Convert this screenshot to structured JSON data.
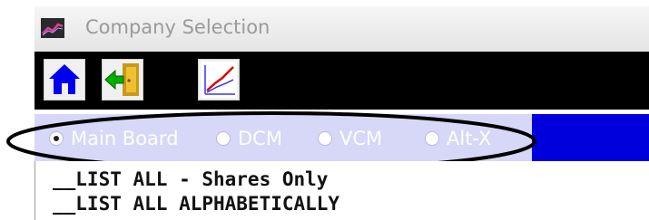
{
  "window": {
    "title": "Company Selection",
    "icon": "chart-app-icon"
  },
  "toolbar": {
    "buttons": [
      {
        "name": "home",
        "icon": "home-icon"
      },
      {
        "name": "exit",
        "icon": "exit-door-icon"
      },
      {
        "name": "chart",
        "icon": "line-chart-icon"
      }
    ]
  },
  "board_options": {
    "selected": "Main Board",
    "options": [
      "Main Board",
      "DCM",
      "VCM",
      "Alt-X"
    ]
  },
  "list": {
    "items": [
      "__LIST ALL - Shares Only",
      "__LIST ALL ALPHABETICALLY"
    ]
  },
  "colors": {
    "toolbar_bg": "#000000",
    "strip_bg": "#d7d7f7",
    "strip_accent": "#0000dd",
    "highlight_ellipse": "#000000"
  }
}
